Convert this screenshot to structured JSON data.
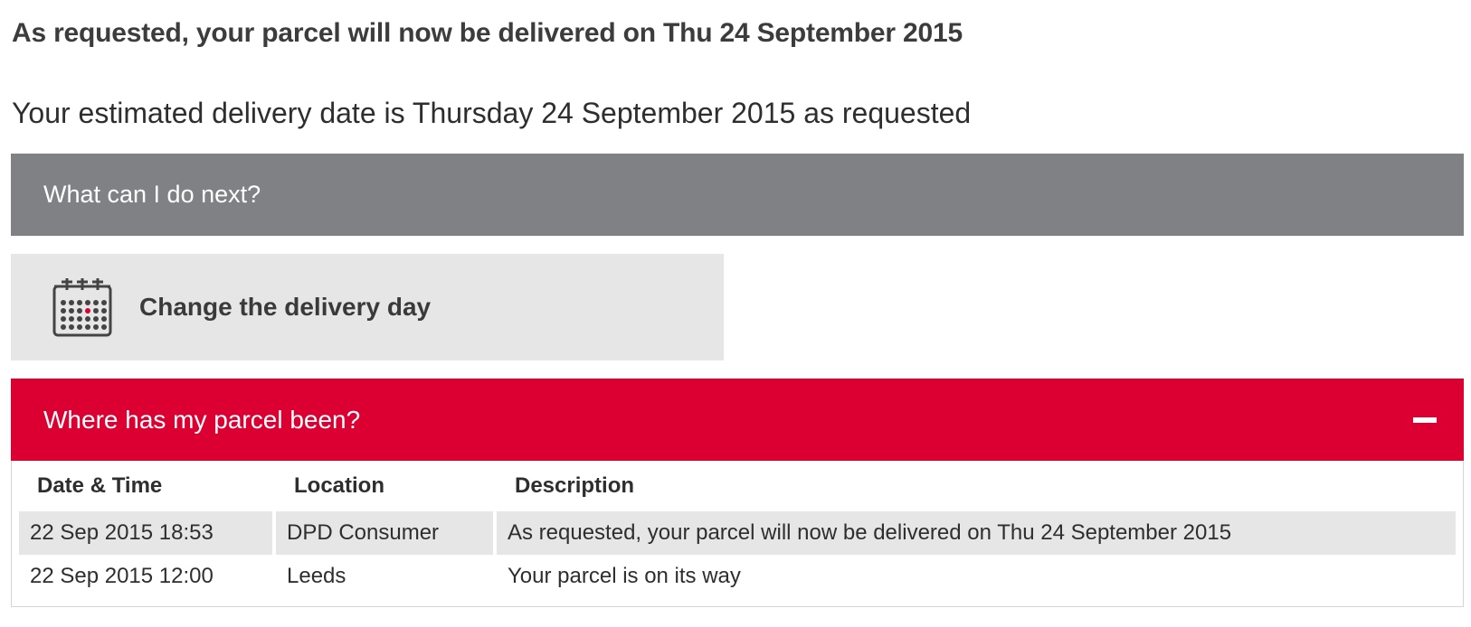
{
  "header": {
    "headline": "As requested, your parcel will now be delivered on Thu 24 September 2015",
    "estimate": "Your estimated delivery date is Thursday 24 September 2015 as requested"
  },
  "next_section": {
    "title": "What can I do next?",
    "actions": [
      {
        "label": "Change the delivery day",
        "icon": "calendar-icon"
      }
    ]
  },
  "tracking": {
    "title": "Where has my parcel been?",
    "toggle_icon": "minus-icon",
    "columns": [
      "Date & Time",
      "Location",
      "Description"
    ],
    "rows": [
      {
        "datetime": "22 Sep 2015 18:53",
        "location": "DPD Consumer",
        "description": "As requested, your parcel will now be delivered on Thu 24 September 2015"
      },
      {
        "datetime": "22 Sep 2015 12:00",
        "location": "Leeds",
        "description": "Your parcel is on its way"
      }
    ]
  },
  "colors": {
    "accent": "#dc0032",
    "section_grey": "#808184",
    "tile_grey": "#e6e6e6"
  }
}
